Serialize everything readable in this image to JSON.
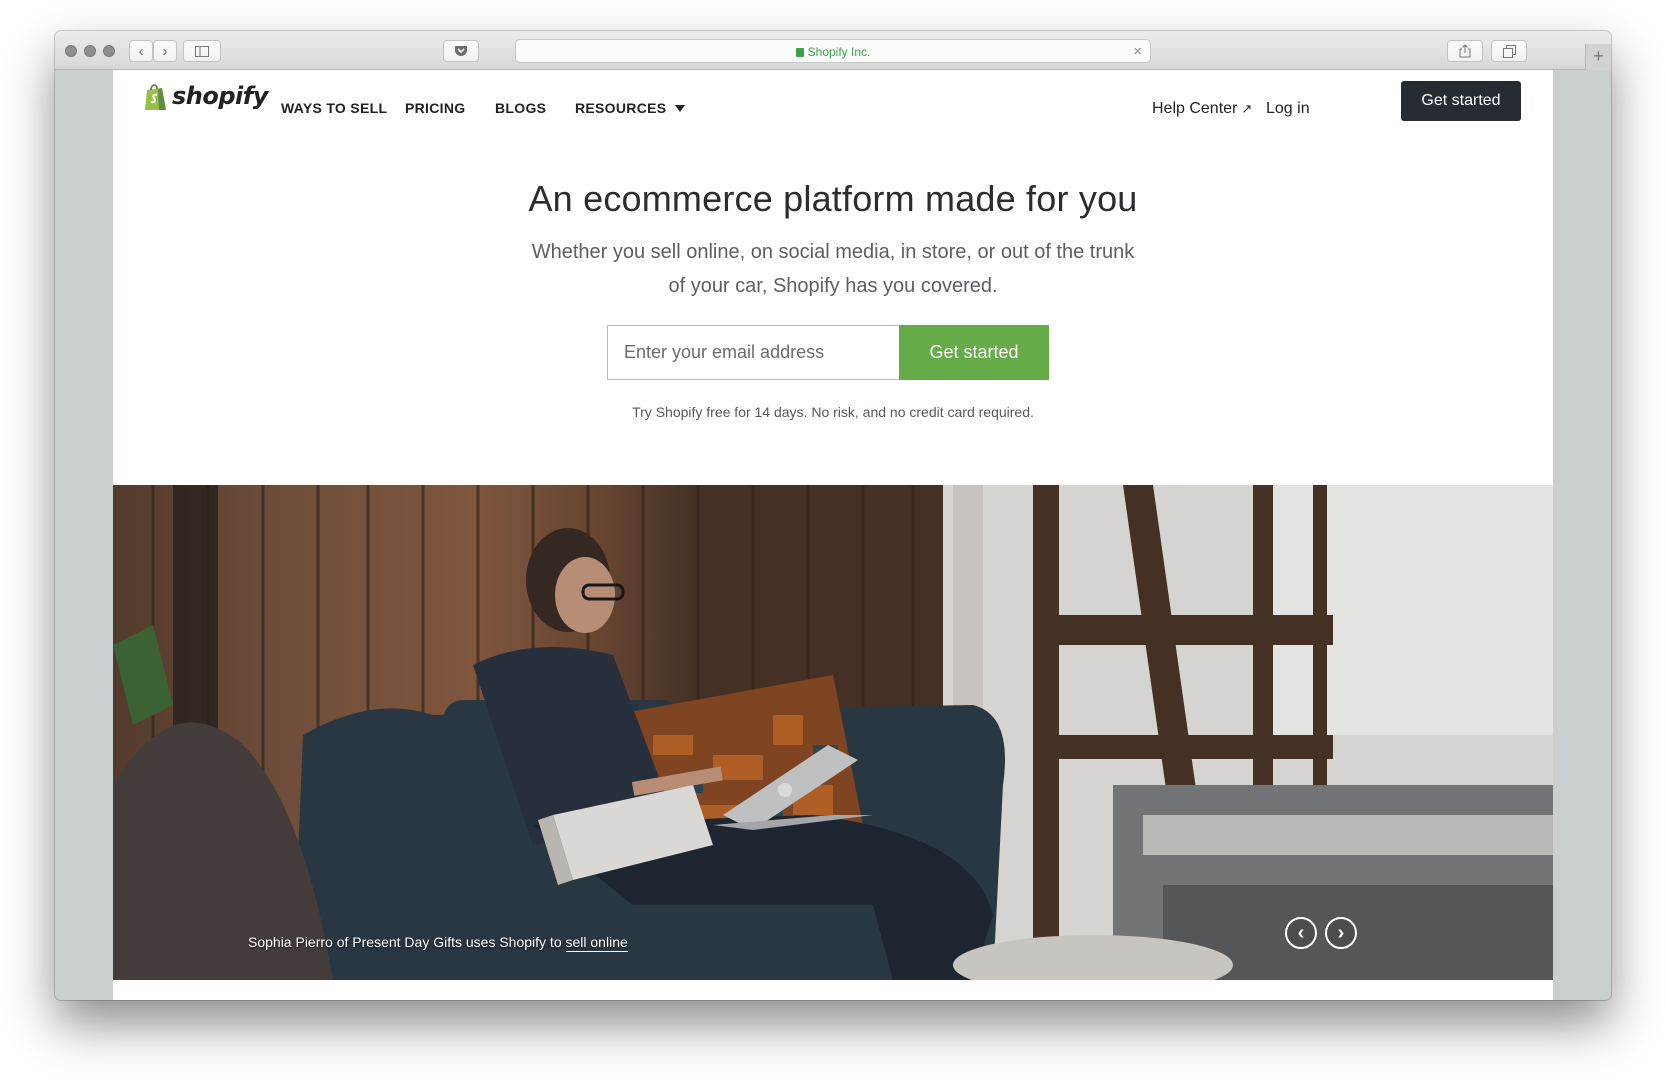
{
  "browser": {
    "address_bar_text": "Shopify Inc.",
    "icons": [
      "back-icon",
      "forward-icon",
      "sidebar-icon",
      "pocket-icon",
      "lock-icon",
      "close-icon",
      "share-icon",
      "tabs-icon",
      "new-tab-icon"
    ]
  },
  "nav": {
    "logo_text": "shopify",
    "items": [
      {
        "label": "WAYS TO SELL"
      },
      {
        "label": "PRICING"
      },
      {
        "label": "BLOGS"
      },
      {
        "label": "RESOURCES"
      }
    ],
    "help_center": "Help Center",
    "help_center_arrow": "↗",
    "login": "Log in",
    "get_started": "Get started"
  },
  "hero": {
    "title": "An ecommerce platform made for you",
    "subtitle": "Whether you sell online, on social media, in store, or out of the trunk of your car, Shopify has you covered.",
    "email_placeholder": "Enter your email address",
    "cta": "Get started",
    "trial_note": "Try Shopify free for 14 days. No risk, and no credit card required."
  },
  "carousel": {
    "caption_prefix": "Sophia Pierro of Present Day Gifts uses Shopify to",
    "caption_link": "sell online",
    "prev_label": "‹",
    "next_label": "›"
  },
  "colors": {
    "brand_green": "#65ab48",
    "dark_button": "#262c31",
    "text_dark": "#2a2c30"
  }
}
